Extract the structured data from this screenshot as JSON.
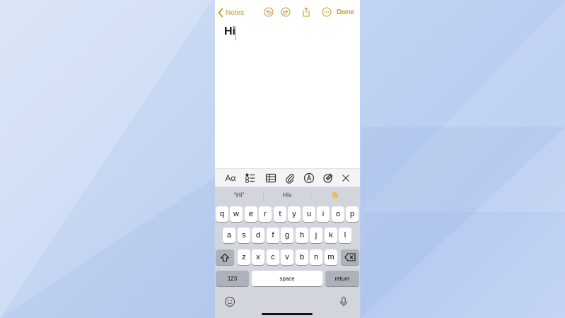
{
  "nav": {
    "back_label": "Notes",
    "done_label": "Done",
    "accent": "#c8992a",
    "icons": [
      "undo-icon",
      "redo-icon",
      "share-icon",
      "more-icon"
    ]
  },
  "note": {
    "text": "Hi"
  },
  "format_bar": {
    "text_style_label": "Aα",
    "icons": [
      "checklist-icon",
      "table-icon",
      "attachment-icon",
      "markup-icon",
      "sketch-icon",
      "close-icon"
    ]
  },
  "keyboard": {
    "predictions": [
      "“Hi”",
      "His",
      "👋"
    ],
    "row1": [
      "q",
      "w",
      "e",
      "r",
      "t",
      "y",
      "u",
      "i",
      "o",
      "p"
    ],
    "row2": [
      "a",
      "s",
      "d",
      "f",
      "g",
      "h",
      "j",
      "k",
      "l"
    ],
    "row3": [
      "z",
      "x",
      "c",
      "v",
      "b",
      "n",
      "m"
    ],
    "numbers_label": "123",
    "space_label": "space",
    "return_label": "return"
  }
}
